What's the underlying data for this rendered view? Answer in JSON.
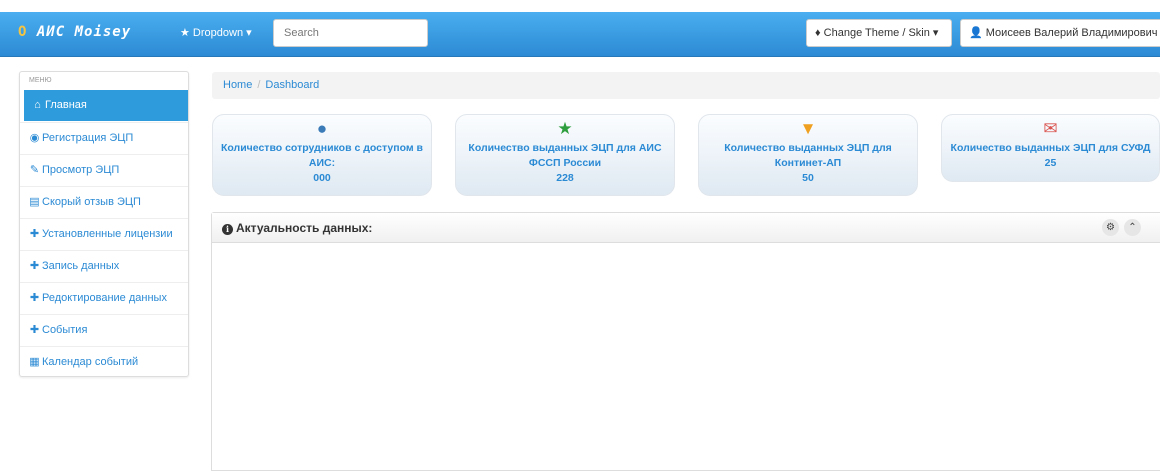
{
  "navbar": {
    "brand_prefix": "O",
    "brand_name": "АИС Moisey",
    "dropdown_label": "★ Dropdown ▾",
    "search_placeholder": "Search",
    "theme_button": "♦ Change Theme / Skin ▾",
    "user_button": "Моисеев Валерий Владимирович ▾"
  },
  "sidebar": {
    "header": "МЕНЮ",
    "items": [
      {
        "label": "Главная",
        "icon": "home-icon"
      },
      {
        "label": "Регистрация ЭЦП",
        "icon": "eye-icon"
      },
      {
        "label": "Просмотр ЭЦП",
        "icon": "edit-icon"
      },
      {
        "label": "Скорый отзыв ЭЦП",
        "icon": "list-icon"
      },
      {
        "label": "Установленные лицензии",
        "icon": "plus-icon"
      },
      {
        "label": "Запись данных",
        "icon": "plus-icon"
      },
      {
        "label": "Редоктирование данных",
        "icon": "plus-icon"
      },
      {
        "label": "События",
        "icon": "plus-icon"
      },
      {
        "label": "Календар событий",
        "icon": "calendar-icon"
      }
    ]
  },
  "breadcrumb": {
    "home": "Home",
    "current": "Dashboard"
  },
  "stats": [
    {
      "label": "Количество сотрудников с доступом в АИС:",
      "value": "000",
      "icon": "user-icon",
      "color": "#3a7bb8"
    },
    {
      "label": "Количество выданных ЭЦП для АИС ФССП России",
      "value": "228",
      "icon": "star-icon",
      "color": "#2e9e3e"
    },
    {
      "label": "Количество выданных ЭЦП для Континет-АП",
      "value": "50",
      "icon": "cart-icon",
      "color": "#f0a020"
    },
    {
      "label": "Количество выданных ЭЦП для СУФД",
      "value": "25",
      "icon": "envelope-icon",
      "color": "#d9534f"
    }
  ],
  "panel": {
    "title": "Актуальность данных:"
  },
  "colors": {
    "accent": "#2e9bdc",
    "link": "#2b8ad4",
    "navbar": "#3a9ee0"
  }
}
